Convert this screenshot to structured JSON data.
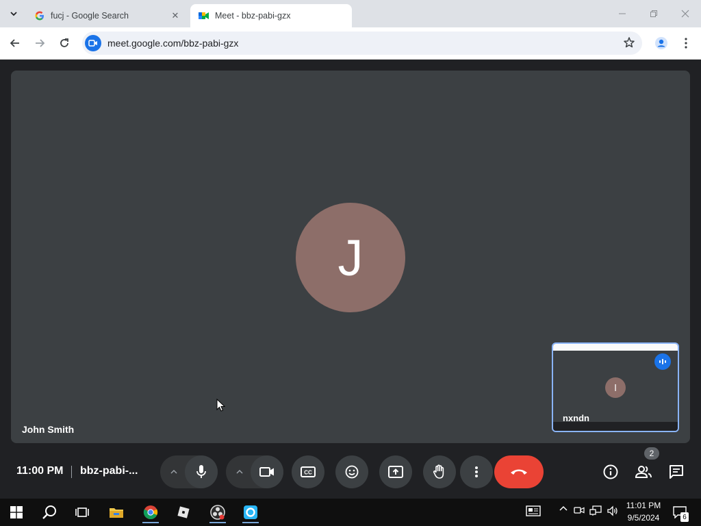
{
  "browser": {
    "tabs": [
      {
        "title": "fucj - Google Search",
        "favicon": "google-g-icon",
        "active": false
      },
      {
        "title": "Meet - bbz-pabi-gzx",
        "favicon": "meet-icon",
        "active": true
      }
    ],
    "url": "meet.google.com/bbz-pabi-gzx"
  },
  "meet": {
    "main_tile": {
      "initial": "J",
      "name": "John Smith",
      "avatar_color": "#8d6e69"
    },
    "self_view": {
      "initial": "l",
      "name": "nxndn",
      "speaking_indicator": "audio-level-icon"
    },
    "footer": {
      "time": "11:00 PM",
      "meeting_code": "bbz-pabi-..."
    },
    "controls": [
      "mic-icon",
      "camera-icon",
      "captions-icon",
      "emoji-icon",
      "present-icon",
      "raise-hand-icon",
      "more-options-icon",
      "hang-up-icon"
    ],
    "right_controls": [
      "info-icon",
      "people-icon",
      "chat-icon"
    ],
    "participant_count": "2",
    "hangup_color": "#ea4335"
  },
  "taskbar": {
    "apps": [
      "windows-start-icon",
      "search-icon",
      "task-view-icon",
      "file-explorer-icon",
      "chrome-icon",
      "roblox-icon",
      "obs-icon",
      "app-icon"
    ],
    "time": "11:01 PM",
    "date": "9/5/2024",
    "notifications": "6"
  }
}
